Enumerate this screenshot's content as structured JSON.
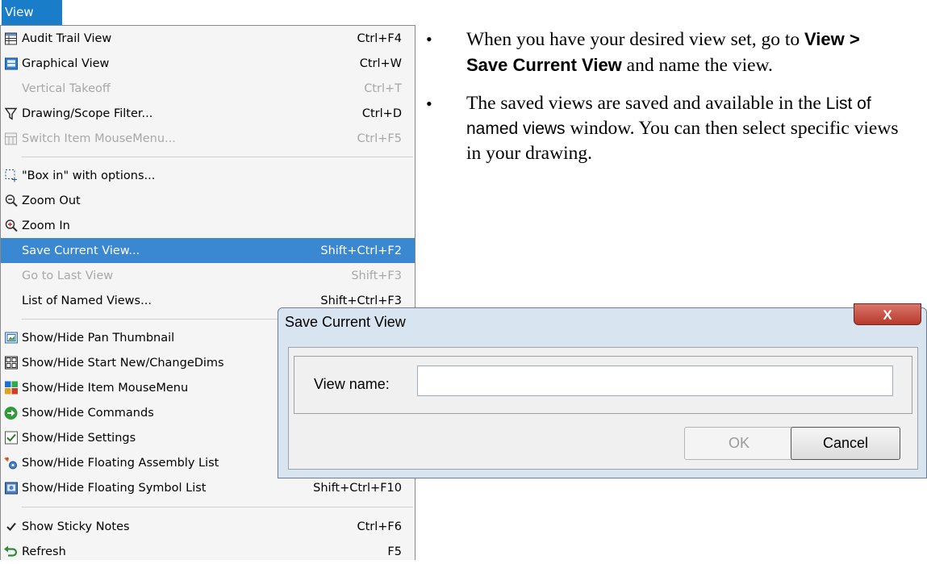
{
  "menu": {
    "title": "View",
    "items": [
      {
        "label": "Audit Trail View",
        "shortcut": "Ctrl+F4",
        "icon": "table-icon"
      },
      {
        "label": "Graphical View",
        "shortcut": "Ctrl+W",
        "icon": "graphical-view-icon"
      },
      {
        "label": "Vertical Takeoff",
        "shortcut": "Ctrl+T",
        "icon": ""
      },
      {
        "label": "Drawing/Scope Filter...",
        "shortcut": "Ctrl+D",
        "icon": "filter-icon"
      },
      {
        "label": "Switch Item MouseMenu...",
        "shortcut": "Ctrl+F5",
        "icon": "mousemenu-icon"
      },
      {
        "label": "\"Box in\" with options...",
        "shortcut": "",
        "icon": "box-in-icon"
      },
      {
        "label": "Zoom Out",
        "shortcut": "",
        "icon": "zoom-out-icon"
      },
      {
        "label": "Zoom In",
        "shortcut": "",
        "icon": "zoom-in-icon"
      },
      {
        "label": "Save Current View...",
        "shortcut": "Shift+Ctrl+F2",
        "icon": ""
      },
      {
        "label": "Go to Last View",
        "shortcut": "Shift+F3",
        "icon": ""
      },
      {
        "label": "List of Named Views...",
        "shortcut": "Shift+Ctrl+F3",
        "icon": ""
      },
      {
        "label": "Show/Hide Pan Thumbnail",
        "shortcut": "",
        "icon": "pan-thumbnail-icon"
      },
      {
        "label": "Show/Hide Start New/ChangeDims",
        "shortcut": "",
        "icon": "grid-icon"
      },
      {
        "label": "Show/Hide Item MouseMenu",
        "shortcut": "",
        "icon": "color-grid-icon"
      },
      {
        "label": "Show/Hide Commands",
        "shortcut": "",
        "icon": "commands-arrow-icon"
      },
      {
        "label": "Show/Hide Settings",
        "shortcut": "",
        "icon": "checkbox-checked-icon"
      },
      {
        "label": "Show/Hide Floating Assembly List",
        "shortcut": "",
        "icon": "gear-icon"
      },
      {
        "label": "Show/Hide Floating Symbol List",
        "shortcut": "Shift+Ctrl+F10",
        "icon": "symbol-list-icon"
      },
      {
        "label": "Show Sticky Notes",
        "shortcut": "Ctrl+F6",
        "icon": "checkmark-icon"
      },
      {
        "label": "Refresh",
        "shortcut": "F5",
        "icon": "refresh-icon"
      }
    ]
  },
  "bullets": {
    "b1_pre": "When you have your desired view set, go to ",
    "b1_bold": "View > Save Current View",
    "b1_post": " and name the view.",
    "b2_pre": "The saved views are saved and available in the ",
    "b2_sans": "List of named views",
    "b2_post": " window. You can then select specific views in your drawing."
  },
  "dialog": {
    "title": "Save Current View",
    "close_label": "X",
    "field_label": "View name:",
    "field_value": "",
    "ok_label": "OK",
    "cancel_label": "Cancel"
  },
  "colors": {
    "menu_selected": "#3a87d2",
    "menu_title_bg": "#1a7dc9",
    "disabled_text": "#a8a8a8",
    "close_button": "#c0483a"
  }
}
